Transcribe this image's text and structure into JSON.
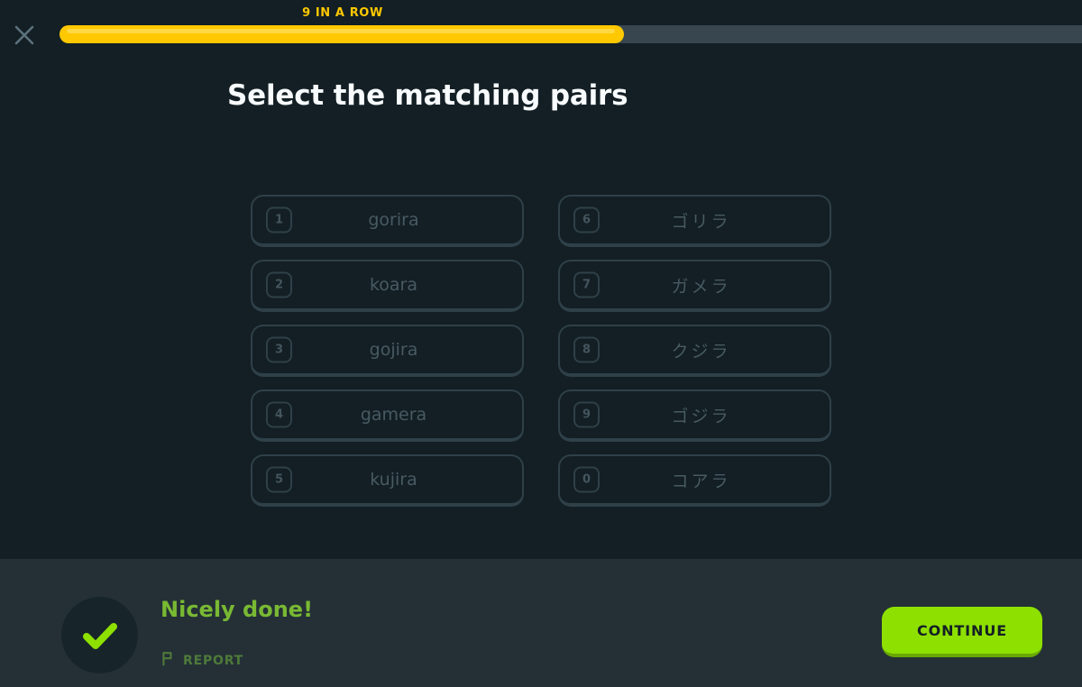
{
  "header": {
    "streak_label": "9 IN A ROW",
    "close_icon": "close-x-icon",
    "progress": {
      "percent": 54,
      "fill_color": "#ffc800",
      "track_color": "#37464f"
    }
  },
  "main": {
    "title": "Select the matching pairs",
    "left_column": [
      {
        "number": "1",
        "text": "gorira"
      },
      {
        "number": "2",
        "text": "koara"
      },
      {
        "number": "3",
        "text": "gojira"
      },
      {
        "number": "4",
        "text": "gamera"
      },
      {
        "number": "5",
        "text": "kujira"
      }
    ],
    "right_column": [
      {
        "number": "6",
        "text": "ゴリラ"
      },
      {
        "number": "7",
        "text": "ガメラ"
      },
      {
        "number": "8",
        "text": "クジラ"
      },
      {
        "number": "9",
        "text": "ゴジラ"
      },
      {
        "number": "0",
        "text": "コアラ"
      }
    ]
  },
  "footer": {
    "check_icon": "checkmark-icon",
    "feedback_title": "Nicely done!",
    "report_icon": "flag-icon",
    "report_label": "REPORT",
    "continue_label": "CONTINUE",
    "accent_green": "#8ee000",
    "feedback_green": "#79b933",
    "background": "#243036"
  }
}
